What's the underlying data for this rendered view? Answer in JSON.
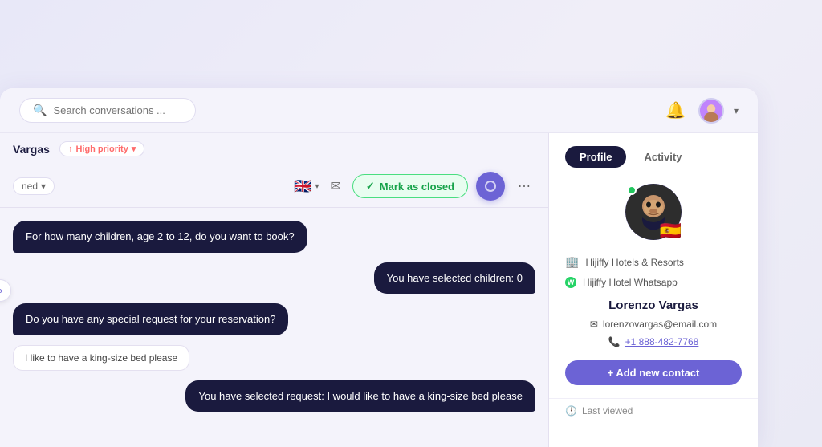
{
  "header": {
    "search_placeholder": "Search conversations ...",
    "bell_icon": "bell-icon",
    "chevron_icon": "chevron-down-icon"
  },
  "chat": {
    "contact_name": "Vargas",
    "priority_label": "High priority",
    "assigned_label": "ned",
    "mark_closed_label": "Mark as closed",
    "messages": [
      {
        "text": "For how many children, age 2 to 12, do you want to book?",
        "type": "bot"
      },
      {
        "text": "You have selected children: 0",
        "type": "user-right"
      },
      {
        "text": "Do you have any special request for your reservation?",
        "type": "bot"
      },
      {
        "text": "I like to have a king-size bed please",
        "type": "small"
      },
      {
        "text": "You have selected request: I would like to have a king-size bed please",
        "type": "user-right"
      }
    ]
  },
  "profile": {
    "tab_profile": "Profile",
    "tab_activity": "Activity",
    "company": "Hijiffy Hotels & Resorts",
    "channel": "Hijiffy Hotel Whatsapp",
    "name": "Lorenzo Vargas",
    "email": "lorenzovargas@email.com",
    "phone": "+1 888-482-7768",
    "add_contact_label": "+ Add new contact",
    "last_viewed_label": "Last viewed",
    "flag_emoji": "🇪🇸"
  }
}
